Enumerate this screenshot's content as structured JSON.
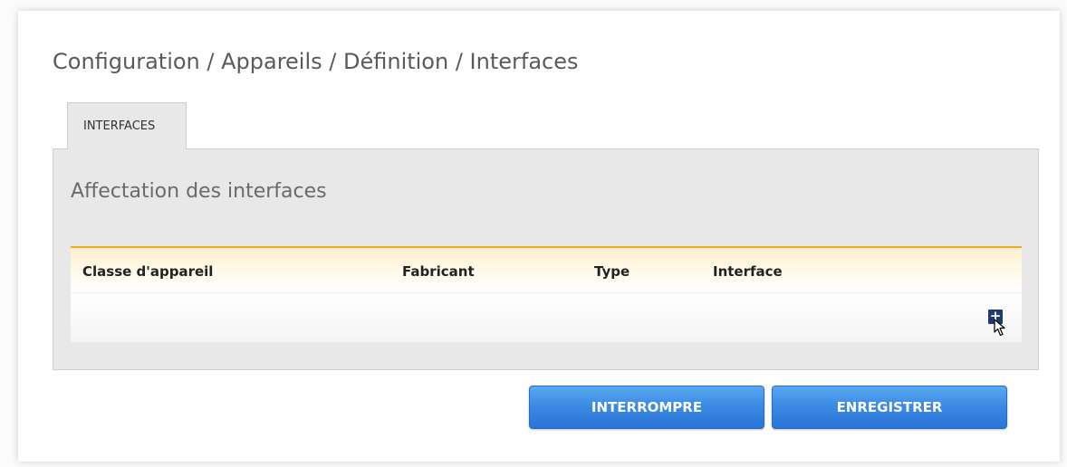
{
  "breadcrumb": "Configuration / Appareils / Définition / Interfaces",
  "tabs": [
    {
      "label": "INTERFACES",
      "active": true
    }
  ],
  "section": {
    "title": "Affectation des interfaces"
  },
  "table": {
    "columns": [
      "Classe d'appareil",
      "Fabricant",
      "Type",
      "Interface"
    ],
    "rows": [],
    "add_icon": "plus-icon",
    "add_symbol": "+"
  },
  "buttons": {
    "cancel_label": "INTERROMPRE",
    "save_label": "ENREGISTRER"
  },
  "colors": {
    "accent_orange": "#f5a623",
    "button_blue": "#3c8be4",
    "add_icon_navy": "#1e3c6e"
  }
}
